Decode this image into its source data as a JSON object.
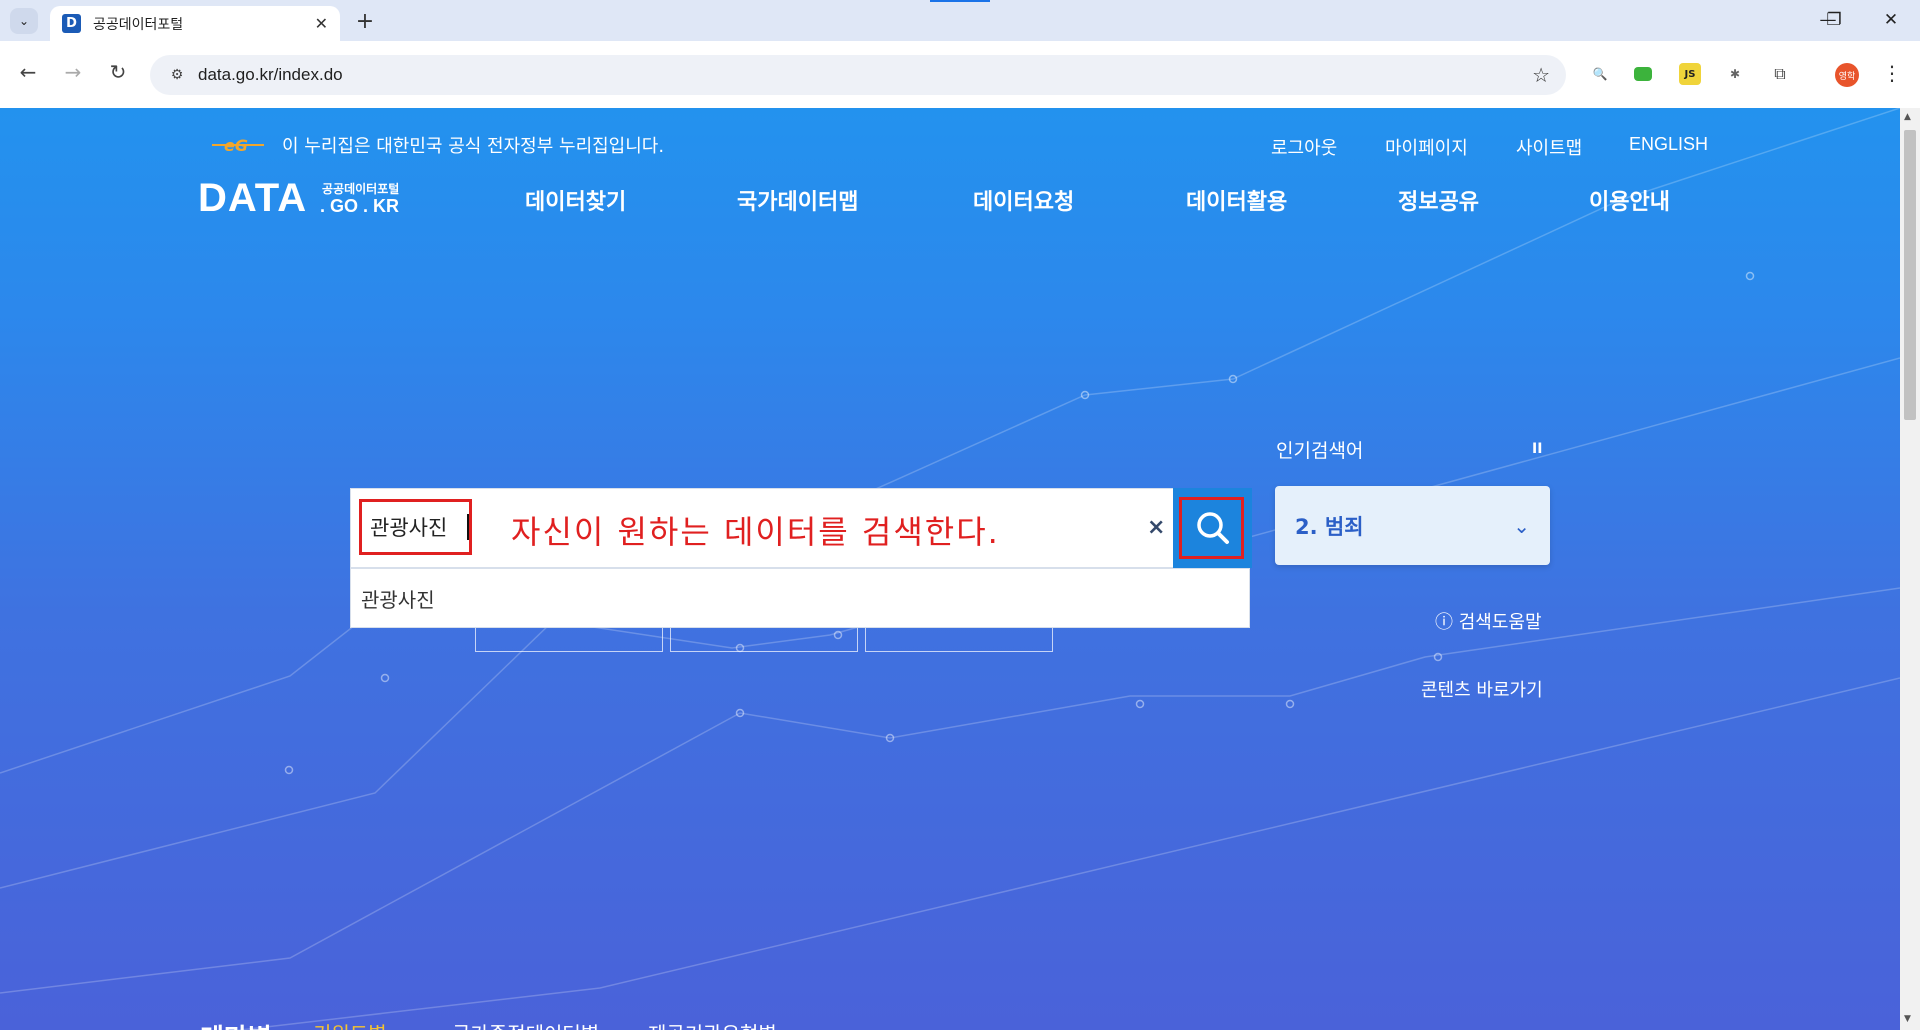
{
  "browser": {
    "tab_title": "공공데이터포털",
    "favicon_letter": "D",
    "url": "data.go.kr/index.do",
    "profile_label": "영학"
  },
  "header": {
    "gov_notice": "이 누리집은 대한민국 공식 전자정부 누리집입니다.",
    "util_links": [
      "로그아웃",
      "마이페이지",
      "사이트맵",
      "ENGLISH"
    ],
    "brand": {
      "big": "DATA",
      "small_kr": "공공데이터포털",
      "small_en": ". GO . KR"
    },
    "gnb": [
      "데이터찾기",
      "국가데이터맵",
      "데이터요청",
      "데이터활용",
      "정보공유",
      "이용안내"
    ]
  },
  "search": {
    "value": "관광사진",
    "annotation": "자신이 원하는 데이터를 검색한다.",
    "clear_symbol": "×",
    "suggestion": "관광사진"
  },
  "popular": {
    "label": "인기검색어",
    "pause_symbol": "II",
    "current": "2. 범죄"
  },
  "links": {
    "help": "검색도움말",
    "contents_shortcut": "콘텐츠 바로가기"
  },
  "bottom_tabs": [
    "테마별",
    "키워드별",
    "국가중점데이터별",
    "제공기관유형별"
  ],
  "colors": {
    "accent": "#1c84dd",
    "annotation_red": "#e02020",
    "active_tab": "#f5c330"
  }
}
